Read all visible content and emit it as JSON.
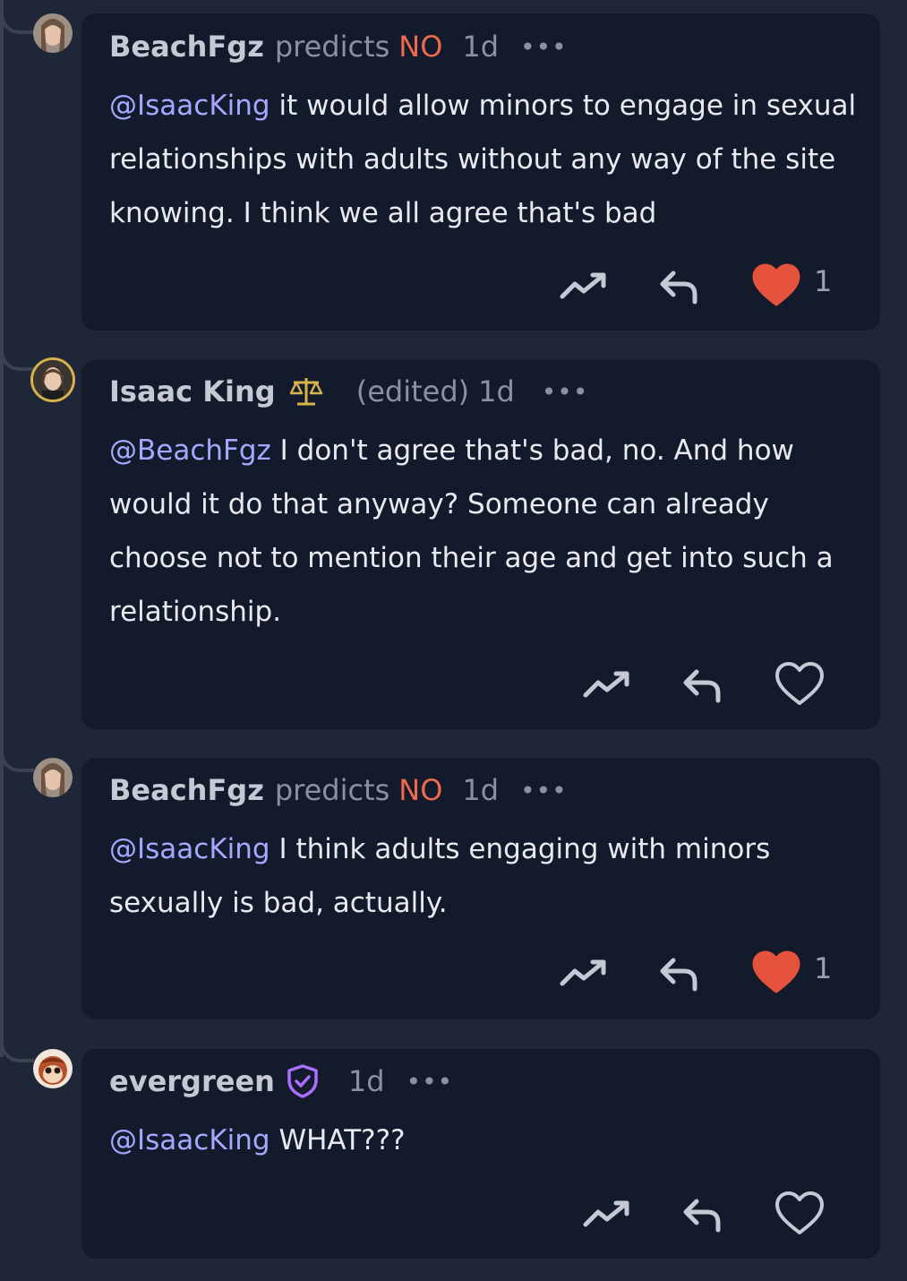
{
  "comments": [
    {
      "author": "BeachFgz",
      "predicts_label": "predicts",
      "prediction": "NO",
      "time": "1d",
      "more": "•••",
      "mention": "@IsaacKing",
      "text": " it would allow minors to engage in sexual relationships with adults without any way of the site knowing. I think we all agree that's bad",
      "liked": true,
      "like_count": "1"
    },
    {
      "author": "Isaac King",
      "edited_label": "(edited)",
      "time": "1d",
      "more": "•••",
      "mention": "@BeachFgz",
      "text": " I don't agree that's bad, no. And how would it do that anyway? Someone can already choose not to mention their age and get into such a relationship.",
      "liked": false
    },
    {
      "author": "BeachFgz",
      "predicts_label": "predicts",
      "prediction": "NO",
      "time": "1d",
      "more": "•••",
      "mention": "@IsaacKing",
      "text": " I think adults engaging with minors sexually is bad, actually.",
      "liked": true,
      "like_count": "1"
    },
    {
      "author": "evergreen",
      "time": "1d",
      "more": "•••",
      "mention": "@IsaacKing",
      "text": " WHAT???",
      "liked": false
    }
  ],
  "colors": {
    "background": "#1f2637",
    "card": "#121a2c",
    "mention": "#a6a8ff",
    "prediction_no": "#ee6a4d",
    "heart_filled": "#e5533c",
    "moderator_badge": "#d8b24a",
    "verified_badge": "#a970ff"
  },
  "icons": {
    "tip": "trending-up-icon",
    "reply": "reply-icon",
    "like": "heart-icon",
    "moderator": "scale-icon",
    "verified": "shield-check-icon"
  }
}
